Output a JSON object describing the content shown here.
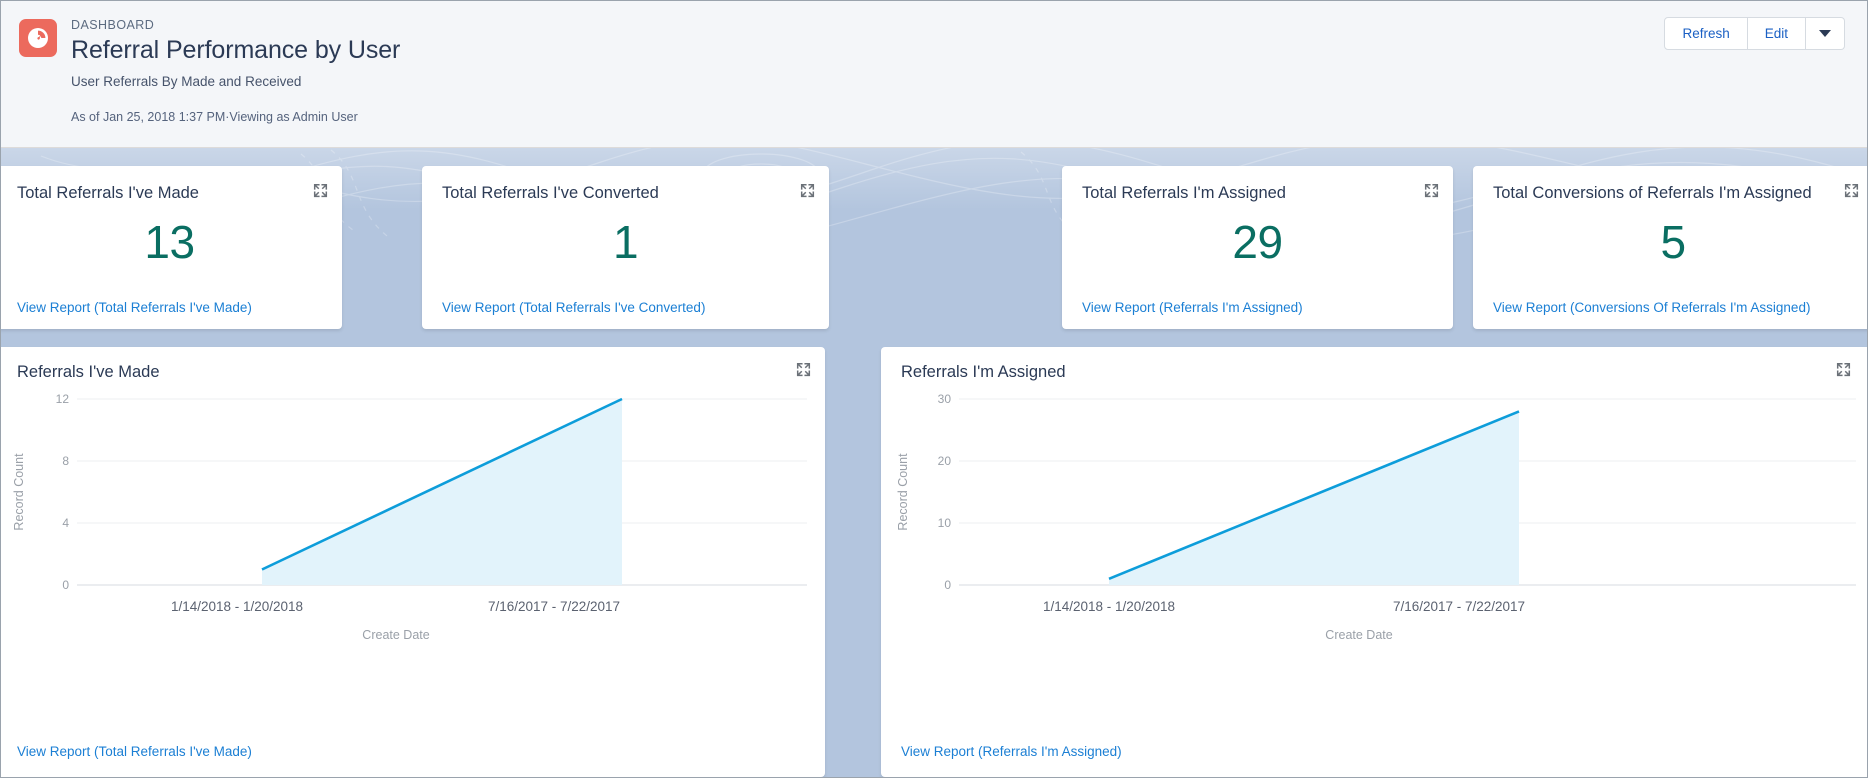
{
  "header": {
    "eyebrow": "DASHBOARD",
    "title": "Referral Performance by User",
    "subtitle": "User Referrals By Made and Received",
    "meta": "As of Jan 25, 2018 1:37 PM·Viewing as Admin User",
    "icon": "dashboard-gauge-icon",
    "icon_color": "#ec6a5d",
    "actions": {
      "refresh_label": "Refresh",
      "edit_label": "Edit",
      "more_label": "chevron-down-icon"
    }
  },
  "colors": {
    "canvas_background": "#b3c5de",
    "card_background": "#ffffff",
    "kpi_value": "#0a6e62",
    "link": "#1b7fd4",
    "title": "#2b3a55",
    "chart_line": "#0d9dda",
    "chart_fill": "#e2f3fb"
  },
  "kpi_cards": [
    {
      "title": "Total Referrals I've Made",
      "value": "13",
      "link": "View Report (Total Referrals I've Made)",
      "expand": "expand-icon"
    },
    {
      "title": "Total Referrals I've Converted",
      "value": "1",
      "link": "View Report (Total Referrals I've Converted)",
      "expand": "expand-icon"
    },
    {
      "title": "Total Referrals I'm Assigned",
      "value": "29",
      "link": "View Report (Referrals I'm Assigned)",
      "expand": "expand-icon"
    },
    {
      "title": "Total Conversions of Referrals I'm Assigned",
      "value": "5",
      "link": "View Report (Conversions Of Referrals I'm Assigned)",
      "expand": "expand-icon"
    }
  ],
  "chart_cards": [
    {
      "title": "Referrals I've Made",
      "link": "View Report (Total Referrals I've Made)",
      "expand": "expand-icon"
    },
    {
      "title": "Referrals I'm Assigned",
      "link": "View Report (Referrals I'm Assigned)",
      "expand": "expand-icon"
    }
  ],
  "chart_data": [
    {
      "type": "area",
      "title": "Referrals I've Made",
      "categories": [
        "1/14/2018 - 1/20/2018",
        "7/16/2017 - 7/22/2017"
      ],
      "values": [
        1,
        12
      ],
      "xlabel": "Create Date",
      "ylabel": "Record Count",
      "yticks": [
        0,
        4,
        8,
        12
      ],
      "ylim": [
        0,
        12
      ],
      "grid": true,
      "legend": "none",
      "line_color": "#0d9dda",
      "fill_color": "#e2f3fb"
    },
    {
      "type": "area",
      "title": "Referrals I'm Assigned",
      "categories": [
        "1/14/2018 - 1/20/2018",
        "7/16/2017 - 7/22/2017"
      ],
      "values": [
        1,
        28
      ],
      "xlabel": "Create Date",
      "ylabel": "Record Count",
      "yticks": [
        0,
        10,
        20,
        30
      ],
      "ylim": [
        0,
        30
      ],
      "grid": true,
      "legend": "none",
      "line_color": "#0d9dda",
      "fill_color": "#e2f3fb"
    }
  ]
}
